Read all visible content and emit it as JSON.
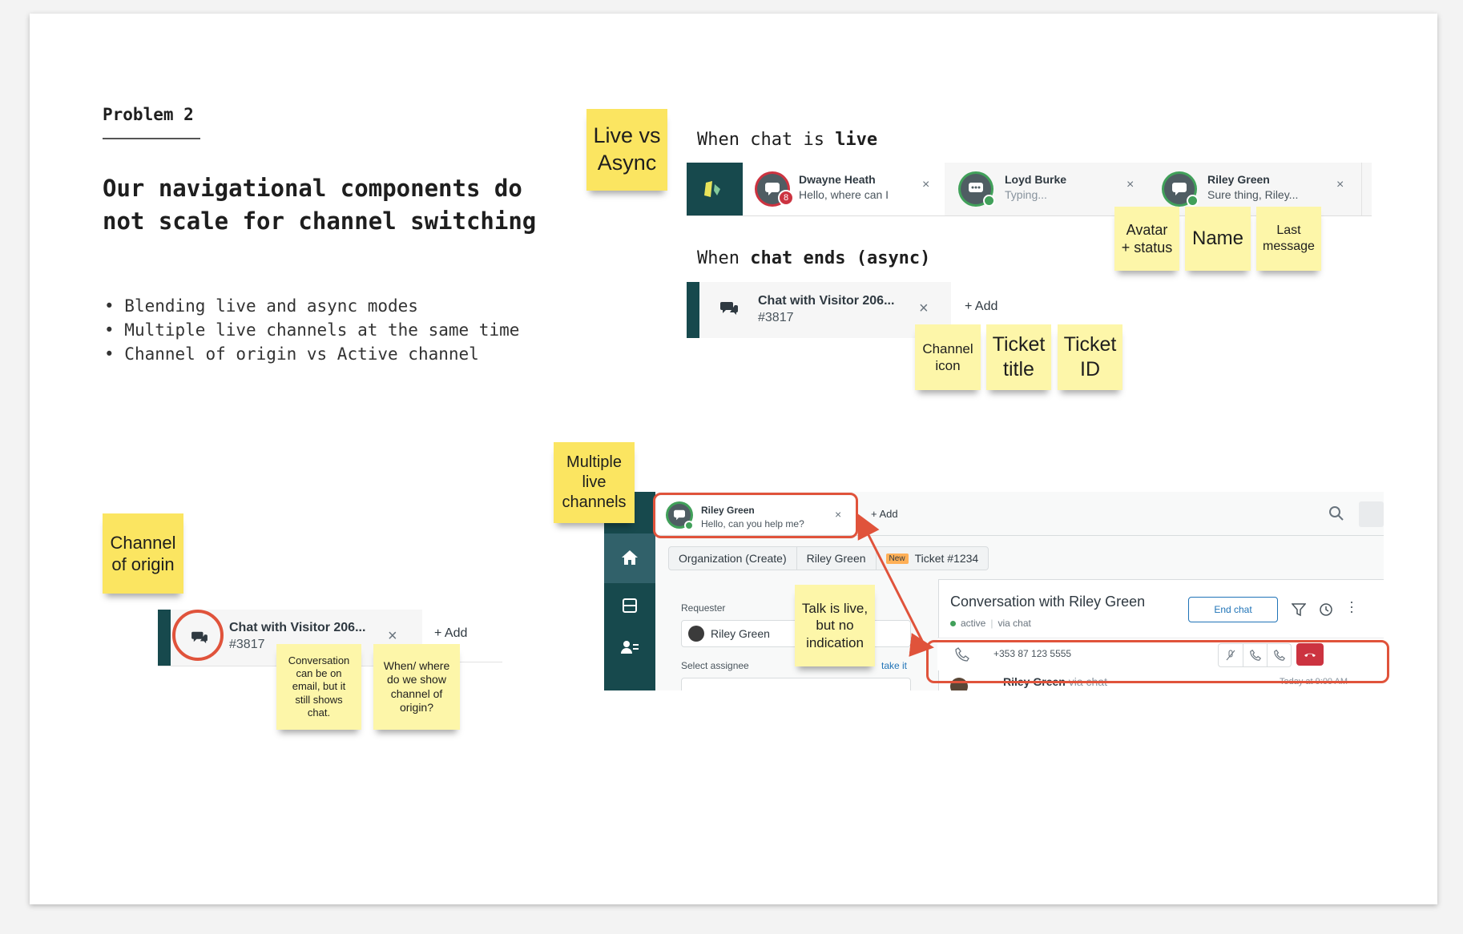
{
  "problem": {
    "kicker": "Problem 2",
    "headline": "Our navigational components do not scale for channel switching",
    "bullets": [
      "Blending live and async modes",
      "Multiple live channels at the same time",
      "Channel of origin vs Active channel"
    ]
  },
  "stickies": {
    "live_vs_async": "Live vs\nAsync",
    "avatar_status": "Avatar\n+ status",
    "name": "Name",
    "last_message": "Last\nmessage",
    "channel_icon": "Channel\nicon",
    "ticket_title": "Ticket\ntitle",
    "ticket_id": "Ticket\nID",
    "channel_of_origin": "Channel\nof origin",
    "conversation_note": "Conversation\ncan be on\nemail, but it\nstill shows\nchat.",
    "when_where": "When/ where\ndo we show\nchannel of\norigin?",
    "multiple_live": "Multiple\nlive\nchannels",
    "talk_live": "Talk is live,\nbut no\nindication"
  },
  "live_section": {
    "label_prefix": "When chat is ",
    "label_bold": "live",
    "tabs": [
      {
        "name": "Dwayne Heath",
        "preview": "Hello, where can I",
        "badge": "8"
      },
      {
        "name": "Loyd Burke",
        "preview": "Typing...",
        "badge": ""
      },
      {
        "name": "Riley Green",
        "preview": "Sure thing, Riley...",
        "badge": ""
      }
    ],
    "close_glyph": "×"
  },
  "async_section": {
    "label_prefix": "When ",
    "label_bold1": "chat ends",
    "label_mid": " ",
    "label_bold2": "(async)",
    "tab_title": "Chat with Visitor 206...",
    "tab_id": "#3817",
    "add_label": "+ Add"
  },
  "origin_example": {
    "tab_title": "Chat with Visitor 206...",
    "tab_id": "#3817",
    "add_label": "+ Add"
  },
  "workspace": {
    "live_tab_name": "Riley Green",
    "live_tab_preview": "Hello, can you help me?",
    "add_label": "+ Add",
    "breadcrumbs": [
      "Organization (Create)",
      "Riley Green",
      "Ticket #1234"
    ],
    "new_badge": "New",
    "requester_label": "Requester",
    "requester_value": "Riley Green",
    "assignee_label": "Select assignee",
    "take_it": "take it",
    "conversation_title": "Conversation with Riley Green",
    "status_active": "active",
    "status_via": "via chat",
    "end_chat": "End chat",
    "phone_number": "+353 87 123 5555",
    "message_author": "Riley Green",
    "message_via": "via chat",
    "message_time": "Today at 9:00 AM"
  },
  "colors": {
    "sticky": "#fbe561",
    "sticky_pale": "#fdf6a9",
    "callout": "#e0533b",
    "sidebar": "#17494d",
    "active_green": "#41a05a",
    "end_call": "#cc3340",
    "link_blue": "#1f73b7"
  }
}
